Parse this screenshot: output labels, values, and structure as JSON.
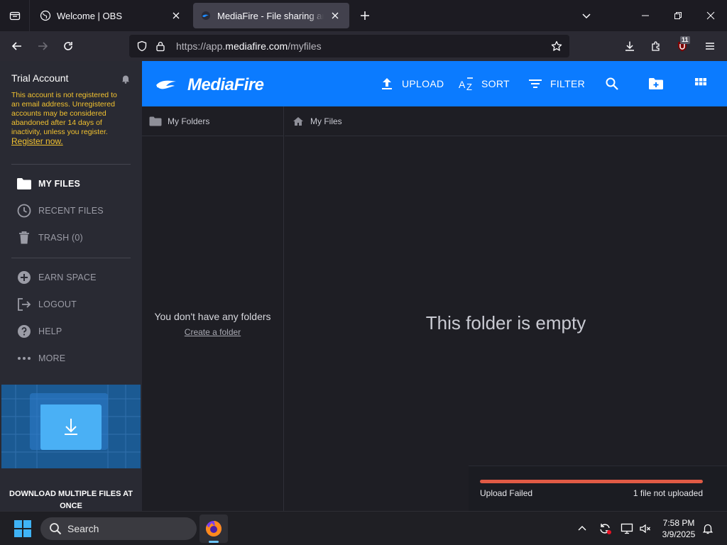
{
  "browser": {
    "tabs": [
      {
        "title": "Welcome | OBS"
      },
      {
        "title": "MediaFire - File sharing and sto"
      }
    ],
    "url_prefix": "https://app.",
    "url_host": "mediafire.com",
    "url_path": "/myfiles",
    "extension_badge": "11"
  },
  "sidebar": {
    "account_title": "Trial Account",
    "account_message": "This account is not registered to an email address. Unregistered accounts may be considered abandoned after 14 days of inactivity, unless you register.",
    "register_link": "Register now.",
    "items": [
      {
        "label": "MY FILES",
        "icon": "folder-icon"
      },
      {
        "label": "RECENT FILES",
        "icon": "clock-icon"
      },
      {
        "label": "TRASH (0)",
        "icon": "trash-icon"
      },
      {
        "label": "EARN SPACE",
        "icon": "plus-circle-icon"
      },
      {
        "label": "LOGOUT",
        "icon": "logout-icon"
      },
      {
        "label": "HELP",
        "icon": "help-icon"
      },
      {
        "label": "MORE",
        "icon": "more-icon"
      }
    ],
    "promo_text": "DOWNLOAD MULTIPLE FILES AT ONCE"
  },
  "header": {
    "logo_text": "MediaFire",
    "actions": [
      {
        "label": "UPLOAD"
      },
      {
        "label": "SORT"
      },
      {
        "label": "FILTER"
      }
    ],
    "accent_color": "#0b7bff"
  },
  "folders_panel": {
    "title": "My Folders",
    "empty_text": "You don't have any folders",
    "create_link": "Create a folder"
  },
  "files_panel": {
    "breadcrumb": "My Files",
    "empty_text": "This folder is empty"
  },
  "upload_panel": {
    "status": "Upload Failed",
    "count_text": "1 file not uploaded",
    "progress": 1.0,
    "bar_color": "#e05a45"
  },
  "taskbar": {
    "search_placeholder": "Search",
    "time": "7:58 PM",
    "date": "3/9/2025"
  }
}
